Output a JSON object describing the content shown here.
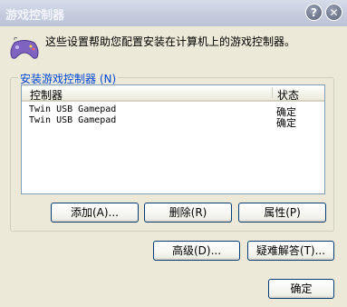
{
  "window": {
    "title": "游戏控制器"
  },
  "titlebar_buttons": {
    "help": "?",
    "close": "✕"
  },
  "description": "这些设置帮助您配置安装在计算机上的游戏控制器。",
  "group": {
    "label": "安装游戏控制器 (N)"
  },
  "list": {
    "columns": [
      "控制器",
      "状态"
    ],
    "rows": [
      {
        "name": "Twin USB Gamepad",
        "status": "确定"
      },
      {
        "name": "Twin USB Gamepad",
        "status": "确定"
      }
    ]
  },
  "buttons": {
    "add": "添加(A)...",
    "remove": "删除(R)",
    "properties": "属性(P)",
    "advanced": "高级(D)...",
    "troubleshoot": "疑难解答(T)...",
    "ok": "确定"
  },
  "colors": {
    "group_label": "#0046D5",
    "list_border": "#7F9DB9",
    "button_border": "#003C74"
  }
}
